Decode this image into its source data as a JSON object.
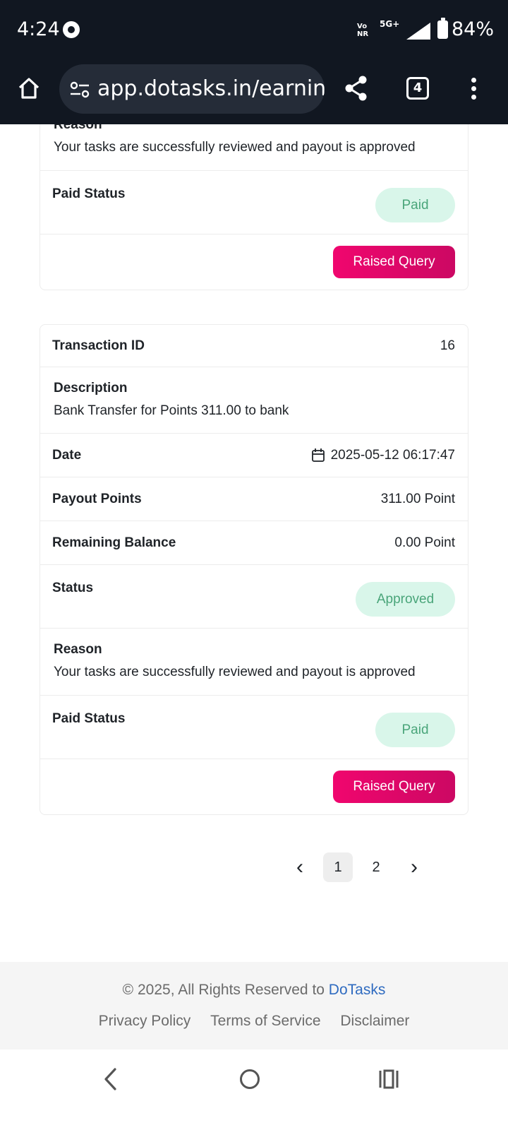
{
  "status_bar": {
    "time": "4:24",
    "network_top": "Vo",
    "network_bottom": "NR",
    "network_type": "5G+",
    "battery": "84%"
  },
  "browser": {
    "url": "app.dotasks.in/earnin",
    "tab_count": "4"
  },
  "prev_card": {
    "reason_label": "Reason",
    "reason_text": "Your tasks are successfully reviewed and payout is approved",
    "paid_status_label": "Paid Status",
    "paid_status": "Paid",
    "query_button": "Raised Query"
  },
  "transaction": {
    "id_label": "Transaction ID",
    "id_value": "16",
    "description_label": "Description",
    "description": "Bank Transfer for Points 311.00 to bank",
    "date_label": "Date",
    "date": "2025-05-12 06:17:47",
    "payout_label": "Payout Points",
    "payout": "311.00 Point",
    "balance_label": "Remaining Balance",
    "balance": "0.00 Point",
    "status_label": "Status",
    "status": "Approved",
    "reason_label": "Reason",
    "reason_text": "Your tasks are successfully reviewed and payout is approved",
    "paid_status_label": "Paid Status",
    "paid_status": "Paid",
    "query_button": "Raised Query"
  },
  "pagination": {
    "prev": "‹",
    "pages": [
      "1",
      "2"
    ],
    "next": "›",
    "active_page": "1"
  },
  "footer": {
    "copyright": "© 2025, All Rights Reserved to ",
    "brand": "DoTasks",
    "links": [
      "Privacy Policy",
      "Terms of Service",
      "Disclaimer"
    ]
  },
  "icons": {
    "chrome": "chrome-icon",
    "signal": "signal-icon",
    "battery": "battery-icon",
    "home": "home-icon",
    "site_settings": "tune-icon",
    "share": "share-icon",
    "menu": "more-vert-icon",
    "calendar": "calendar-icon",
    "nav_back": "back-icon",
    "nav_home": "circle-home-icon",
    "nav_recent": "recents-icon"
  },
  "colors": {
    "status_bg": "#111721",
    "badge_bg": "#d9f6ea",
    "badge_text": "#4aa57a",
    "button": "#e8076b",
    "brand_link": "#2f6bc0"
  }
}
